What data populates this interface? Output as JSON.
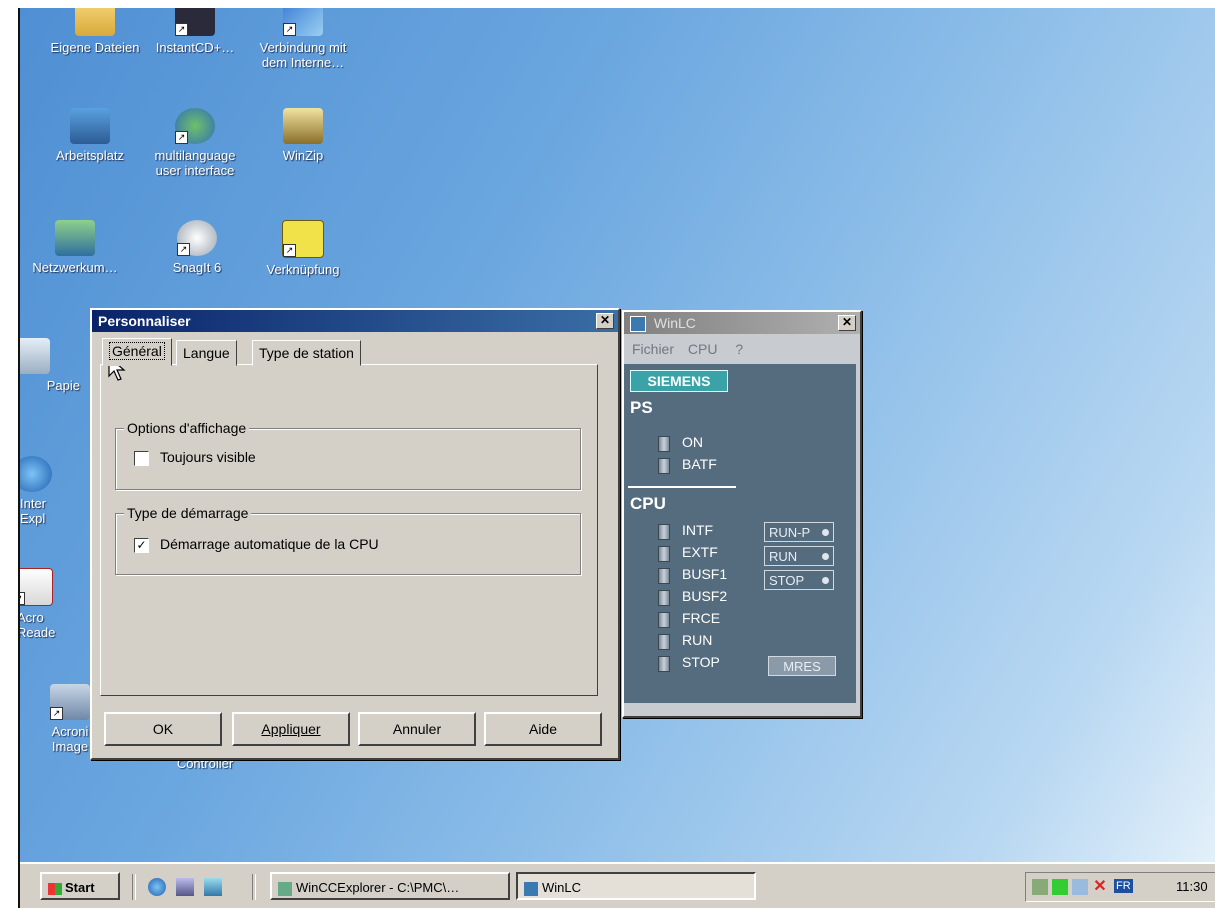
{
  "desktop": {
    "icons": [
      {
        "label": "Eigene Dateien",
        "icon": "folder-icon"
      },
      {
        "label": "InstantCD+…",
        "icon": "instantcd-icon"
      },
      {
        "label": "Verbindung mit dem Interne…",
        "icon": "connection-icon"
      },
      {
        "label": "Arbeitsplatz",
        "icon": "computer-icon"
      },
      {
        "label": "multilanguage user interface",
        "icon": "globe-icon"
      },
      {
        "label": "WinZip",
        "icon": "winzip-icon"
      },
      {
        "label": "Netzwerkum…",
        "icon": "network-icon"
      },
      {
        "label": "SnagIt 6",
        "icon": "snagit-icon"
      },
      {
        "label": "Verknüpfung",
        "icon": "shortcut-icon"
      },
      {
        "label": "Papie",
        "icon": "recycle-bin-icon"
      },
      {
        "label": "Inter Expl",
        "icon": "ie-icon"
      },
      {
        "label": "Acro Reade",
        "icon": "acrobat-icon"
      },
      {
        "label": "Acroni Image",
        "icon": "acronis-icon"
      },
      {
        "label": "Controller",
        "icon": "controller-icon"
      }
    ]
  },
  "dialog": {
    "title": "Personnaliser",
    "tabs": [
      "Général",
      "Langue",
      "Type de station"
    ],
    "group_display": {
      "label": "Options d'affichage",
      "checkbox": "Toujours visible",
      "checked": false
    },
    "group_startup": {
      "label": "Type de démarrage",
      "checkbox": "Démarrage automatique de la CPU",
      "checked": true
    },
    "buttons": {
      "ok": "OK",
      "apply": "Appliquer",
      "cancel": "Annuler",
      "help": "Aide"
    }
  },
  "winlc": {
    "title": "WinLC",
    "menu": [
      "Fichier",
      "CPU",
      "?"
    ],
    "brand": "SIEMENS",
    "ps": {
      "label": "PS",
      "leds": [
        "ON",
        "BATF"
      ]
    },
    "cpu": {
      "label": "CPU",
      "leds": [
        "INTF",
        "EXTF",
        "BUSF1",
        "BUSF2",
        "FRCE",
        "RUN",
        "STOP"
      ]
    },
    "modes": [
      "RUN-P",
      "RUN",
      "STOP"
    ],
    "mres": "MRES"
  },
  "taskbar": {
    "start": "Start",
    "items": [
      "WinCCExplorer - C:\\PMC\\…",
      "WinLC"
    ],
    "lang": "FR",
    "clock": "11:30"
  }
}
